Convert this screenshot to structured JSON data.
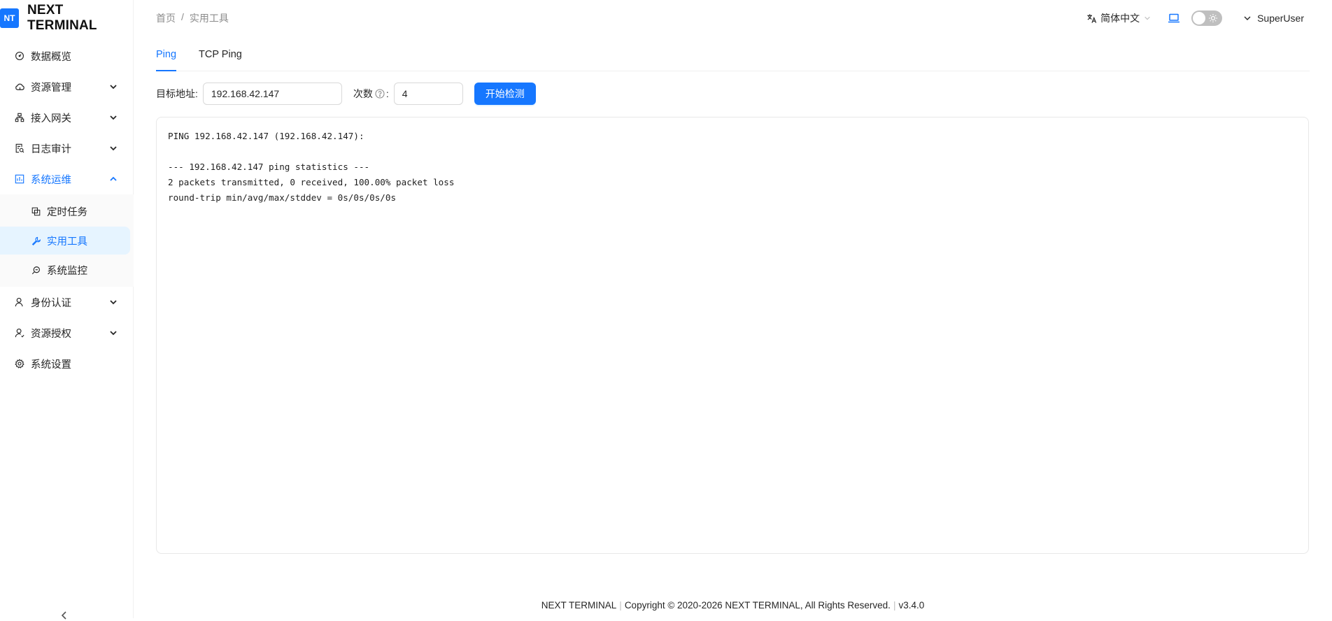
{
  "brand": {
    "logo": "NT",
    "name": "NEXT TERMINAL"
  },
  "sidebar": {
    "items": [
      {
        "label": "数据概览",
        "icon": "dashboard-icon"
      },
      {
        "label": "资源管理",
        "icon": "cloud-icon"
      },
      {
        "label": "接入网关",
        "icon": "gateway-icon"
      },
      {
        "label": "日志审计",
        "icon": "audit-icon"
      },
      {
        "label": "系统运维",
        "icon": "ops-icon"
      },
      {
        "label": "身份认证",
        "icon": "user-icon"
      },
      {
        "label": "资源授权",
        "icon": "authorize-icon"
      },
      {
        "label": "系统设置",
        "icon": "gear-icon"
      }
    ],
    "submenu": [
      {
        "label": "定时任务",
        "icon": "schedule-icon"
      },
      {
        "label": "实用工具",
        "icon": "wrench-icon"
      },
      {
        "label": "系统监控",
        "icon": "monitor-search-icon"
      }
    ]
  },
  "breadcrumb": {
    "home": "首页",
    "sep": "/",
    "current": "实用工具"
  },
  "header": {
    "language": "简体中文",
    "user": "SuperUser"
  },
  "tabs": [
    "Ping",
    "TCP Ping"
  ],
  "form": {
    "target_label": "目标地址:",
    "target_value": "192.168.42.147",
    "count_label": "次数",
    "count_colon": ":",
    "count_value": "4",
    "submit_label": "开始检测"
  },
  "output": {
    "lines": [
      "PING 192.168.42.147 (192.168.42.147):",
      "",
      "--- 192.168.42.147 ping statistics ---",
      "2 packets transmitted, 0 received, 100.00% packet loss",
      "round-trip min/avg/max/stddev = 0s/0s/0s/0s"
    ]
  },
  "footer": {
    "product": "NEXT TERMINAL",
    "copyright": "Copyright © 2020-2026 NEXT TERMINAL, All Rights Reserved.",
    "version": "v3.4.0"
  },
  "colors": {
    "accent": "#1677ff",
    "active_bg": "#e6f4ff"
  }
}
